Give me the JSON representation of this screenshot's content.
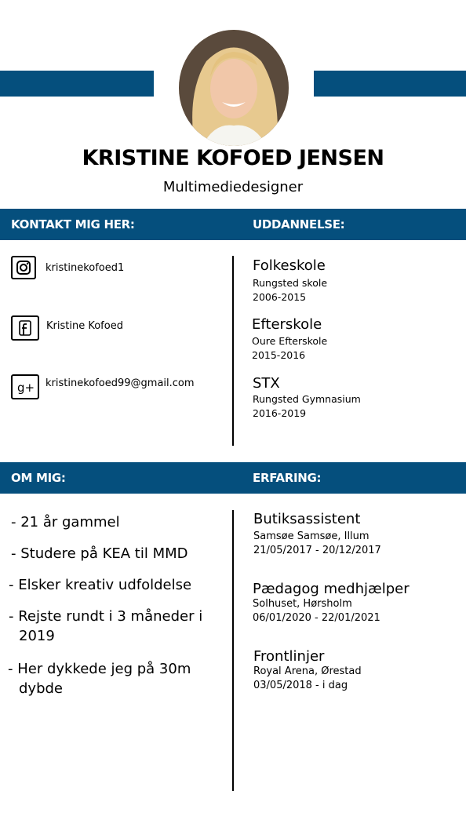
{
  "header": {
    "name": "Kristine Kofoed Jensen",
    "role": "Multimediedesigner",
    "accent": "#054f7d"
  },
  "contact": {
    "title": "Kontakt mig her:",
    "items": [
      {
        "icon": "instagram-icon",
        "text": "kristinekofoed1"
      },
      {
        "icon": "facebook-icon",
        "text": "Kristine Kofoed"
      },
      {
        "icon": "google-plus-icon",
        "text": "kristinekofoed99@gmail.com"
      }
    ]
  },
  "education": {
    "title": "Uddannelse:",
    "items": [
      {
        "title": "Folkeskole",
        "school": "Rungsted skole",
        "years": "2006-2015"
      },
      {
        "title": "Efterskole",
        "school": "Oure Efterskole",
        "years": "2015-2016"
      },
      {
        "title": "STX",
        "school": "Rungsted Gymnasium",
        "years": "2016-2019"
      }
    ]
  },
  "about": {
    "title": "Om mig:",
    "items": [
      {
        "line1": "- 21 år gammel",
        "line2": ""
      },
      {
        "line1": "- Studere på KEA til MMD",
        "line2": ""
      },
      {
        "line1": "- Elsker kreativ udfoldelse",
        "line2": ""
      },
      {
        "line1": "- Rejste rundt i 3 måneder i",
        "line2": "2019"
      },
      {
        "line1": "- Her dykkede jeg på 30m",
        "line2": "dybde"
      }
    ]
  },
  "experience": {
    "title": "Erfaring:",
    "items": [
      {
        "title": "Butiksassistent",
        "place": "Samsøe Samsøe, Illum",
        "dates": "21/05/2017 - 20/12/2017"
      },
      {
        "title": "Pædagog medhjælper",
        "place": "Solhuset, Hørsholm",
        "dates": "06/01/2020 - 22/01/2021"
      },
      {
        "title": "Frontlinjer",
        "place": "Royal Arena, Ørestad",
        "dates": "03/05/2018 - i dag"
      }
    ]
  }
}
